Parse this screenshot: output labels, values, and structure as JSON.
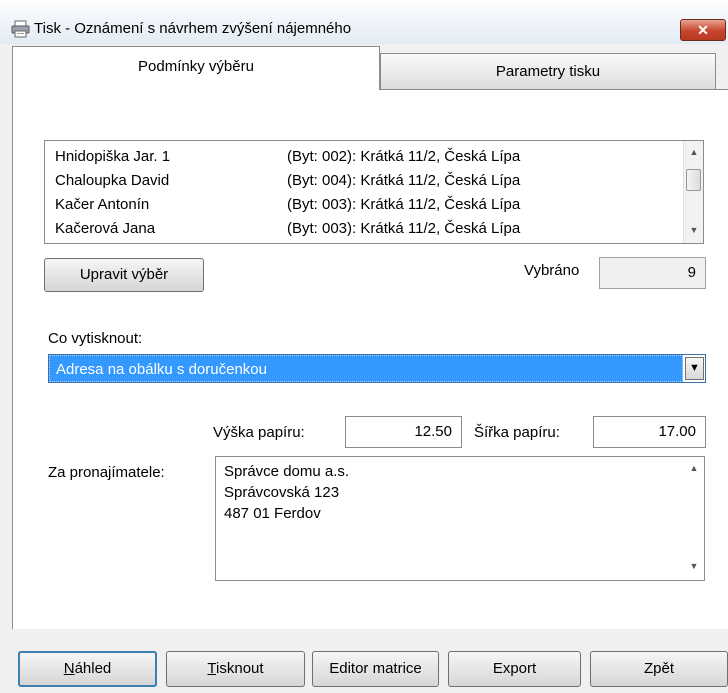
{
  "window": {
    "title": "Tisk - Oznámení s návrhem zvýšení nájemného",
    "close_glyph": "✕"
  },
  "tabs": [
    {
      "label": "Podmínky výběru",
      "active": true
    },
    {
      "label": "Parametry tisku",
      "active": false
    }
  ],
  "tenant_list": [
    {
      "name": "Hnidopiška Jar. 1",
      "address": "(Byt: 002): Krátká 11/2, Česká Lípa"
    },
    {
      "name": "Chaloupka David",
      "address": "(Byt: 004): Krátká 11/2, Česká Lípa"
    },
    {
      "name": "Kačer Antonín",
      "address": "(Byt: 003): Krátká 11/2, Česká Lípa"
    },
    {
      "name": "Kačerová Jana",
      "address": "(Byt: 003): Krátká 11/2, Česká Lípa"
    }
  ],
  "selection": {
    "edit_button": "Upravit výběr",
    "selected_label": "Vybráno",
    "selected_count": "9"
  },
  "print_what": {
    "label": "Co vytisknout:",
    "value": "Adresa na obálku s doručenkou"
  },
  "paper": {
    "height_label": "Výška papíru:",
    "height_value": "12.50",
    "width_label": "Šířka papíru:",
    "width_value": "17.00"
  },
  "landlord": {
    "label": "Za pronajímatele:",
    "lines": [
      "Správce domu a.s.",
      "Správcovská 123",
      "487 01 Ferdov"
    ]
  },
  "footer": {
    "preview": {
      "mnemonic": "N",
      "rest": "áhled"
    },
    "print": {
      "mnemonic": "T",
      "rest": "isknout"
    },
    "editor": "Editor matrice",
    "export": "Export",
    "back": "Zpět"
  },
  "colors": {
    "selection": "#3399ff",
    "close_button": "#c7452e",
    "default_button_border": "#3c7fb1"
  },
  "icons": {
    "window": "printer-icon",
    "combo_dropdown": "triangle-down",
    "scroll_up": "triangle-up",
    "scroll_down": "triangle-down"
  }
}
